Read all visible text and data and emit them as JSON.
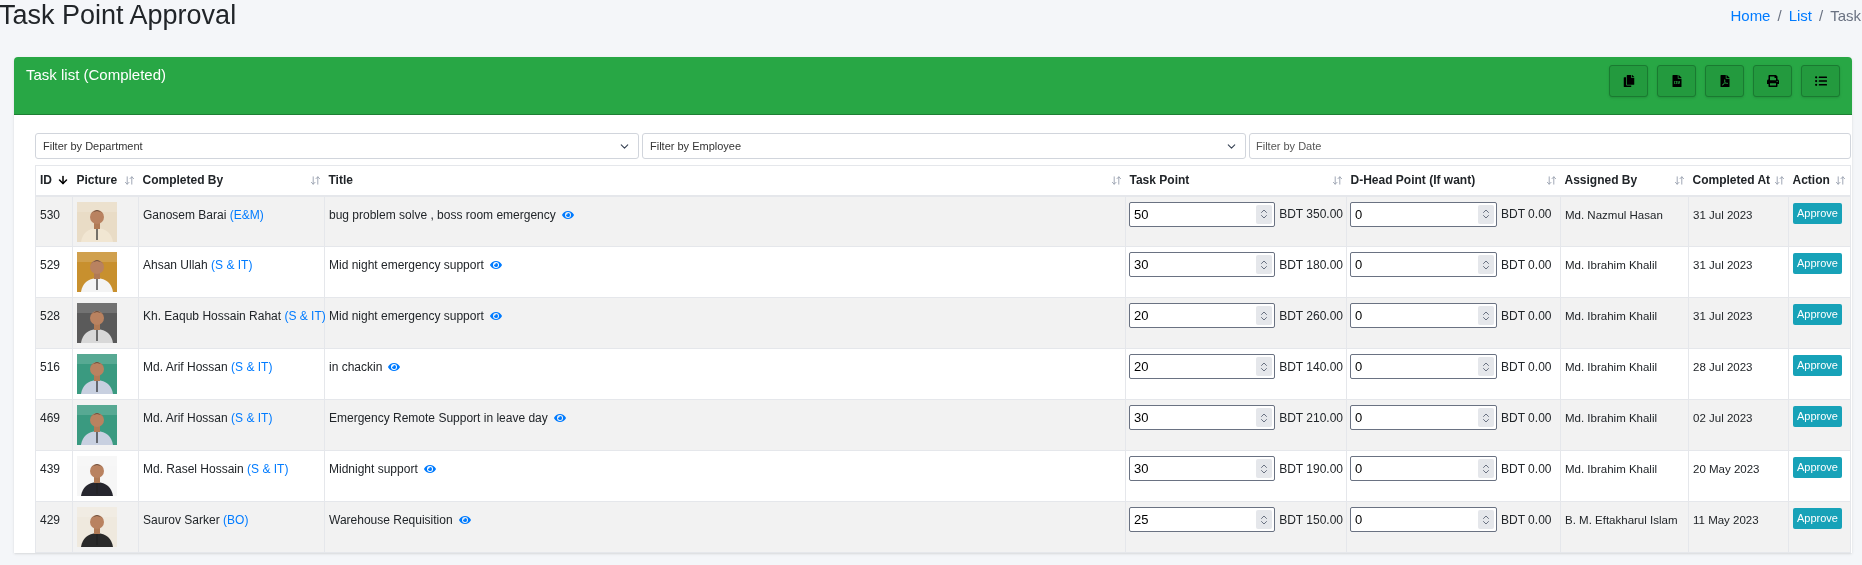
{
  "page_title": "Task Point Approval",
  "breadcrumb": [
    {
      "label": "Home",
      "active": false
    },
    {
      "separator": "/",
      "label": "List",
      "active": false
    },
    {
      "separator": "/",
      "label": "Task",
      "active": true
    }
  ],
  "card": {
    "title": "Task list (Completed)",
    "toolbar": [
      {
        "kind": "copy"
      },
      {
        "kind": "csv"
      },
      {
        "kind": "pdf"
      },
      {
        "kind": "print"
      },
      {
        "kind": "columns"
      }
    ]
  },
  "filters": [
    {
      "kind": "select",
      "label": "Filter by Department"
    },
    {
      "kind": "select",
      "label": "Filter by Employee"
    },
    {
      "kind": "input",
      "placeholder": "Filter by Date"
    }
  ],
  "table": {
    "columns": [
      {
        "label": "ID",
        "sorted": true
      },
      {
        "label": "Picture",
        "sorted": false
      },
      {
        "label": "Completed By",
        "sorted": false
      },
      {
        "label": "Title",
        "sorted": false
      },
      {
        "label": "Task Point",
        "sorted": false
      },
      {
        "label": "D-Head Point (If want)",
        "sorted": false
      },
      {
        "label": "Assigned By",
        "sorted": false
      },
      {
        "label": "Completed At",
        "sorted": false
      },
      {
        "label": "Action",
        "sorted": false
      }
    ],
    "rows": [
      {
        "id": "530",
        "name": "Ganosem Barai",
        "dept": "(E&M)",
        "title": "bug problem solve , boss room emergency",
        "task_point": "50",
        "task_amount": "BDT 350.00",
        "dhead_point": "0",
        "dhead_amount": "BDT 0.00",
        "assigned_by": "Md. Nazmul Hasan",
        "completed_at": "31 Jul 2023",
        "action": "Approve"
      },
      {
        "id": "529",
        "name": "Ahsan Ullah",
        "dept": "(S & IT)",
        "title": "Mid night emergency support",
        "task_point": "30",
        "task_amount": "BDT 180.00",
        "dhead_point": "0",
        "dhead_amount": "BDT 0.00",
        "assigned_by": "Md. Ibrahim Khalil",
        "completed_at": "31 Jul 2023",
        "action": "Approve"
      },
      {
        "id": "528",
        "name": "Kh. Eaqub Hossain Rahat",
        "dept": "(S & IT)",
        "title": "Mid night emergency support",
        "task_point": "20",
        "task_amount": "BDT 260.00",
        "dhead_point": "0",
        "dhead_amount": "BDT 0.00",
        "assigned_by": "Md. Ibrahim Khalil",
        "completed_at": "31 Jul 2023",
        "action": "Approve"
      },
      {
        "id": "516",
        "name": "Md. Arif Hossan",
        "dept": "(S & IT)",
        "title": "in chackin",
        "task_point": "20",
        "task_amount": "BDT 140.00",
        "dhead_point": "0",
        "dhead_amount": "BDT 0.00",
        "assigned_by": "Md. Ibrahim Khalil",
        "completed_at": "28 Jul 2023",
        "action": "Approve"
      },
      {
        "id": "469",
        "name": "Md. Arif Hossan",
        "dept": "(S & IT)",
        "title": "Emergency Remote Support in leave day",
        "task_point": "30",
        "task_amount": "BDT 210.00",
        "dhead_point": "0",
        "dhead_amount": "BDT 0.00",
        "assigned_by": "Md. Ibrahim Khalil",
        "completed_at": "02 Jul 2023",
        "action": "Approve"
      },
      {
        "id": "439",
        "name": "Md. Rasel Hossain",
        "dept": "(S & IT)",
        "title": "Midnight support",
        "task_point": "30",
        "task_amount": "BDT 190.00",
        "dhead_point": "0",
        "dhead_amount": "BDT 0.00",
        "assigned_by": "Md. Ibrahim Khalil",
        "completed_at": "20 May 2023",
        "action": "Approve"
      },
      {
        "id": "429",
        "name": "Saurov Sarker",
        "dept": "(BO)",
        "title": "Warehouse Requisition",
        "task_point": "25",
        "task_amount": "BDT 150.00",
        "dhead_point": "0",
        "dhead_amount": "BDT 0.00",
        "assigned_by": "B. M. Eftakharul Islam",
        "completed_at": "11 May 2023",
        "action": "Approve"
      }
    ]
  }
}
